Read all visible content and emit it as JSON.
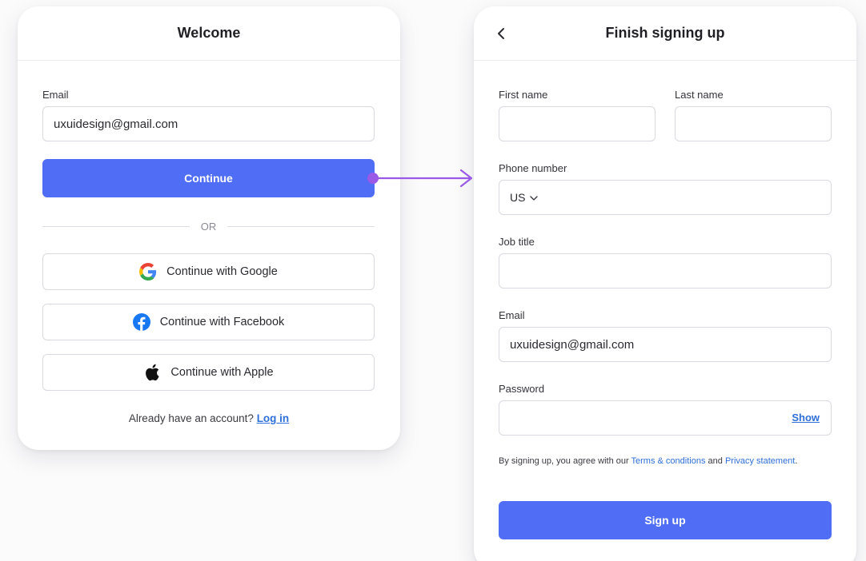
{
  "welcome": {
    "title": "Welcome",
    "email_label": "Email",
    "email_value": "uxuidesign@gmail.com",
    "continue_label": "Continue",
    "or_text": "OR",
    "google_label": "Continue with Google",
    "facebook_label": "Continue with Facebook",
    "apple_label": "Continue with Apple",
    "account_prompt": "Already have an account?",
    "login_link": "Log in"
  },
  "signup": {
    "title": "Finish signing up",
    "back_glyph": "‹",
    "first_name_label": "First name",
    "first_name_value": "",
    "last_name_label": "Last name",
    "last_name_value": "",
    "phone_label": "Phone number",
    "country_code": "US",
    "job_title_label": "Job title",
    "job_title_value": "",
    "email_label": "Email",
    "email_value": "uxuidesign@gmail.com",
    "password_label": "Password",
    "password_value": "",
    "show_label": "Show",
    "terms_prefix": "By signing up, you agree with our",
    "terms_link": "Terms & conditions",
    "terms_and": "and",
    "privacy_link": "Privacy statement",
    "terms_suffix": ".",
    "signup_label": "Sign up"
  },
  "colors": {
    "primary": "#4f6df5",
    "link": "#2e6fd8",
    "flow_arrow": "#9b59e8",
    "google_blue": "#4285F4",
    "google_red": "#EA4335",
    "google_yellow": "#FBBC05",
    "google_green": "#34A853",
    "facebook": "#1877F2"
  },
  "icons": {
    "back": "chevron-left-icon",
    "google": "google-icon",
    "facebook": "facebook-icon",
    "apple": "apple-icon",
    "dropdown": "chevron-down-icon",
    "flow": "flow-arrow-icon"
  }
}
